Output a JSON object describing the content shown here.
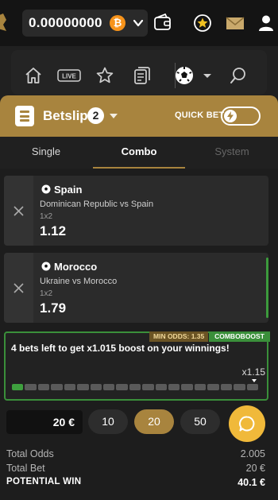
{
  "topbar": {
    "balance": "0.00000000",
    "currency_icon": "bitcoin-icon",
    "icons": [
      "chevron-down-icon",
      "wallet-icon",
      "star-badge-icon",
      "mail-icon",
      "user-icon"
    ]
  },
  "nav": {
    "items": [
      "home-icon",
      "live-icon",
      "favorites-icon",
      "betslip-list-icon",
      "soccer-ball-icon",
      "search-icon"
    ],
    "live_label": "LIVE"
  },
  "betslip": {
    "title": "Betslip",
    "count": "2",
    "quick_bet_label": "QUICK BET",
    "accent_color": "#a8843e"
  },
  "tabs": [
    {
      "label": "Single",
      "active": false
    },
    {
      "label": "Combo",
      "active": true
    },
    {
      "label": "System",
      "active": false
    }
  ],
  "bets": [
    {
      "team": "Spain",
      "match": "Dominican Republic vs Spain",
      "market": "1x2",
      "odds": "1.12"
    },
    {
      "team": "Morocco",
      "match": "Ukraine vs Morocco",
      "market": "1x2",
      "odds": "1.79"
    }
  ],
  "boost": {
    "min_odds_label": "MIN ODDS: 1.35",
    "tag_label": "COMBOBOOST",
    "message": "4 bets left to get x1.015 boost on your winnings!",
    "max_multiplier": "x1.15",
    "progress_filled_segments": 1,
    "progress_total_segments": 19,
    "color": "#3a8f3a"
  },
  "stake": {
    "value": "20 €",
    "chips": [
      "10",
      "20",
      "50"
    ],
    "active_chip": "20"
  },
  "summary": {
    "total_odds_label": "Total Odds",
    "total_odds_value": "2.005",
    "total_bet_label": "Total Bet",
    "total_bet_value": "20 €",
    "potential_win_label": "POTENTIAL WIN",
    "potential_win_value": "40.1 €"
  }
}
